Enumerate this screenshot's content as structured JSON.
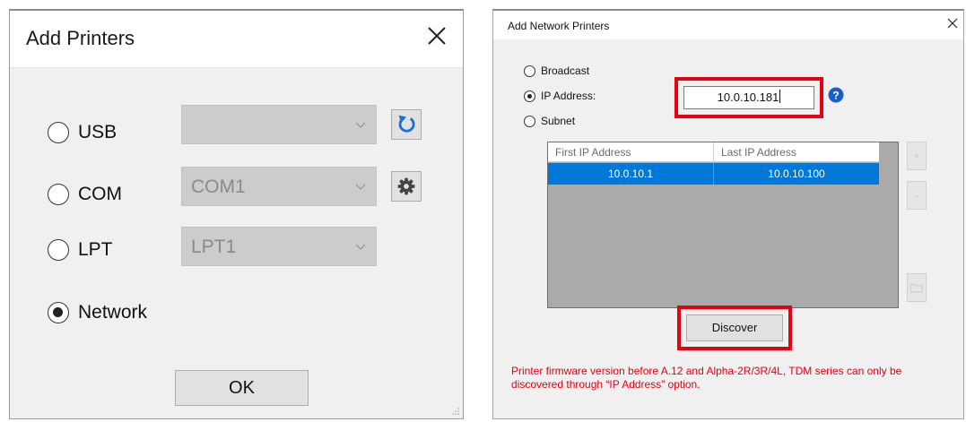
{
  "add_printers": {
    "title": "Add Printers",
    "options": [
      {
        "label": "USB",
        "selected": false
      },
      {
        "label": "COM",
        "selected": false
      },
      {
        "label": "LPT",
        "selected": false
      },
      {
        "label": "Network",
        "selected": true
      }
    ],
    "usb_combo_value": "",
    "com_combo_value": "COM1",
    "lpt_combo_value": "LPT1",
    "ok_label": "OK",
    "icons": {
      "refresh": "refresh-icon",
      "settings": "gear-icon",
      "close": "close-icon"
    }
  },
  "add_network_printers": {
    "title": "Add Network Printers",
    "options": [
      {
        "label": "Broadcast",
        "selected": false
      },
      {
        "label": "IP Address:",
        "selected": true
      },
      {
        "label": "Subnet",
        "selected": false
      }
    ],
    "ip_value": "10.0.10.181",
    "table": {
      "columns": [
        "First IP Address",
        "Last IP Address"
      ],
      "rows": [
        [
          "10.0.10.1",
          "10.0.10.100"
        ]
      ]
    },
    "add_label": "+",
    "remove_label": "-",
    "discover_label": "Discover",
    "warning": "Printer firmware version before A.12 and Alpha-2R/3R/4L, TDM series can only be discovered through “IP Address” option.",
    "colors": {
      "highlight": "#e60012",
      "selection": "#0078d7",
      "warning": "#e60012"
    }
  }
}
